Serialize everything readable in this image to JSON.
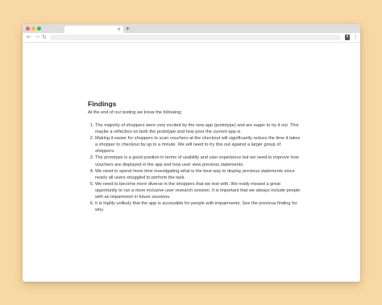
{
  "browser": {
    "tab_close_label": "×",
    "new_tab_label": "+",
    "back_label": "←",
    "forward_label": "→",
    "reload_label": "↻",
    "menu_label": "⋮",
    "icons": [
      "close-icon",
      "plus-icon",
      "back-arrow-icon",
      "forward-arrow-icon",
      "reload-icon",
      "profile-icon",
      "kebab-menu-icon"
    ]
  },
  "colors": {
    "background": "#f8d9a6",
    "window": "#ffffff",
    "tabstrip": "#dedede",
    "close_dot": "#ff5f57",
    "minimize_dot": "#febc2e",
    "maximize_dot": "#28c840"
  },
  "document": {
    "heading": "Findings",
    "intro": "At the end of our testing we know the following;",
    "findings": [
      "The majority of shoppers were very excited by the new app (prototype) and are eager to try it out. This maybe a reflection on both the prototype and how poor the current app is.",
      "Making it easier for shoppers to scan vouchers at the checkout will significantly reduce the time it takes a shopper to checkout by up to a minute. We will need to try this out against a larger group of shoppers.",
      "The prototype is a good position in terms of usability and user experience but we need to improve how vouchers are displayed in the app and how user view previous statements.",
      "We need to spend more time investigating what is the best way to display previous statements since nearly all users struggled to perform the task.",
      "We need to become more diverse in the shoppers that we test with. We really missed a great opportunity to run a more inclusive user research session. It is important that we always include people with an impairment in future sessions.",
      "It is highly unlikely that the app is accessible for people with impairments. See the previous finding for why."
    ]
  }
}
